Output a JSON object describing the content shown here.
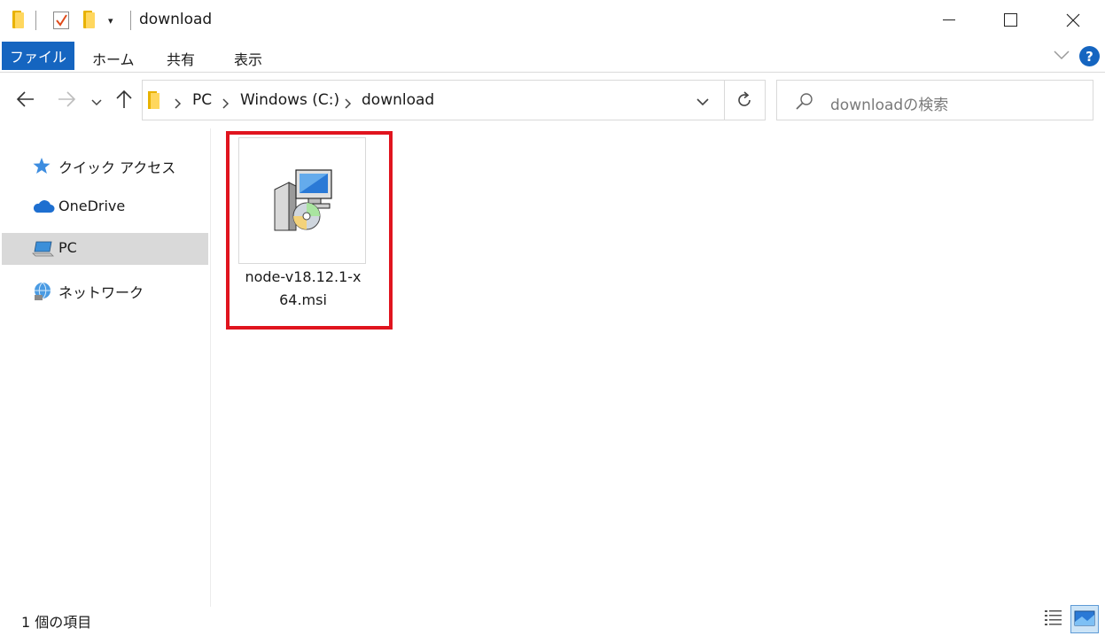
{
  "window": {
    "title": "download",
    "minimize_label": "Minimize",
    "maximize_label": "Maximize",
    "close_label": "Close"
  },
  "quick_access": {
    "dropdown_glyph": "▾"
  },
  "ribbon": {
    "tabs": [
      "ファイル",
      "ホーム",
      "共有",
      "表示"
    ],
    "help_glyph": "?"
  },
  "address": {
    "crumbs": [
      "PC",
      "Windows (C:)",
      "download"
    ]
  },
  "search": {
    "placeholder": "downloadの検索"
  },
  "sidebar": {
    "items": [
      {
        "label": "クイック アクセス",
        "icon": "star-icon",
        "selected": false
      },
      {
        "label": "OneDrive",
        "icon": "cloud-icon",
        "selected": false
      },
      {
        "label": "PC",
        "icon": "computer-icon",
        "selected": true
      },
      {
        "label": "ネットワーク",
        "icon": "network-icon",
        "selected": false
      }
    ]
  },
  "files": [
    {
      "name_line1": "node-v18.12.1-x",
      "name_line2": "64.msi",
      "icon": "msi-installer-icon"
    }
  ],
  "status": {
    "text": "1 個の項目"
  },
  "colors": {
    "accent": "#1565c0",
    "highlight": "#e0141e",
    "selection": "#d9d9d9"
  }
}
